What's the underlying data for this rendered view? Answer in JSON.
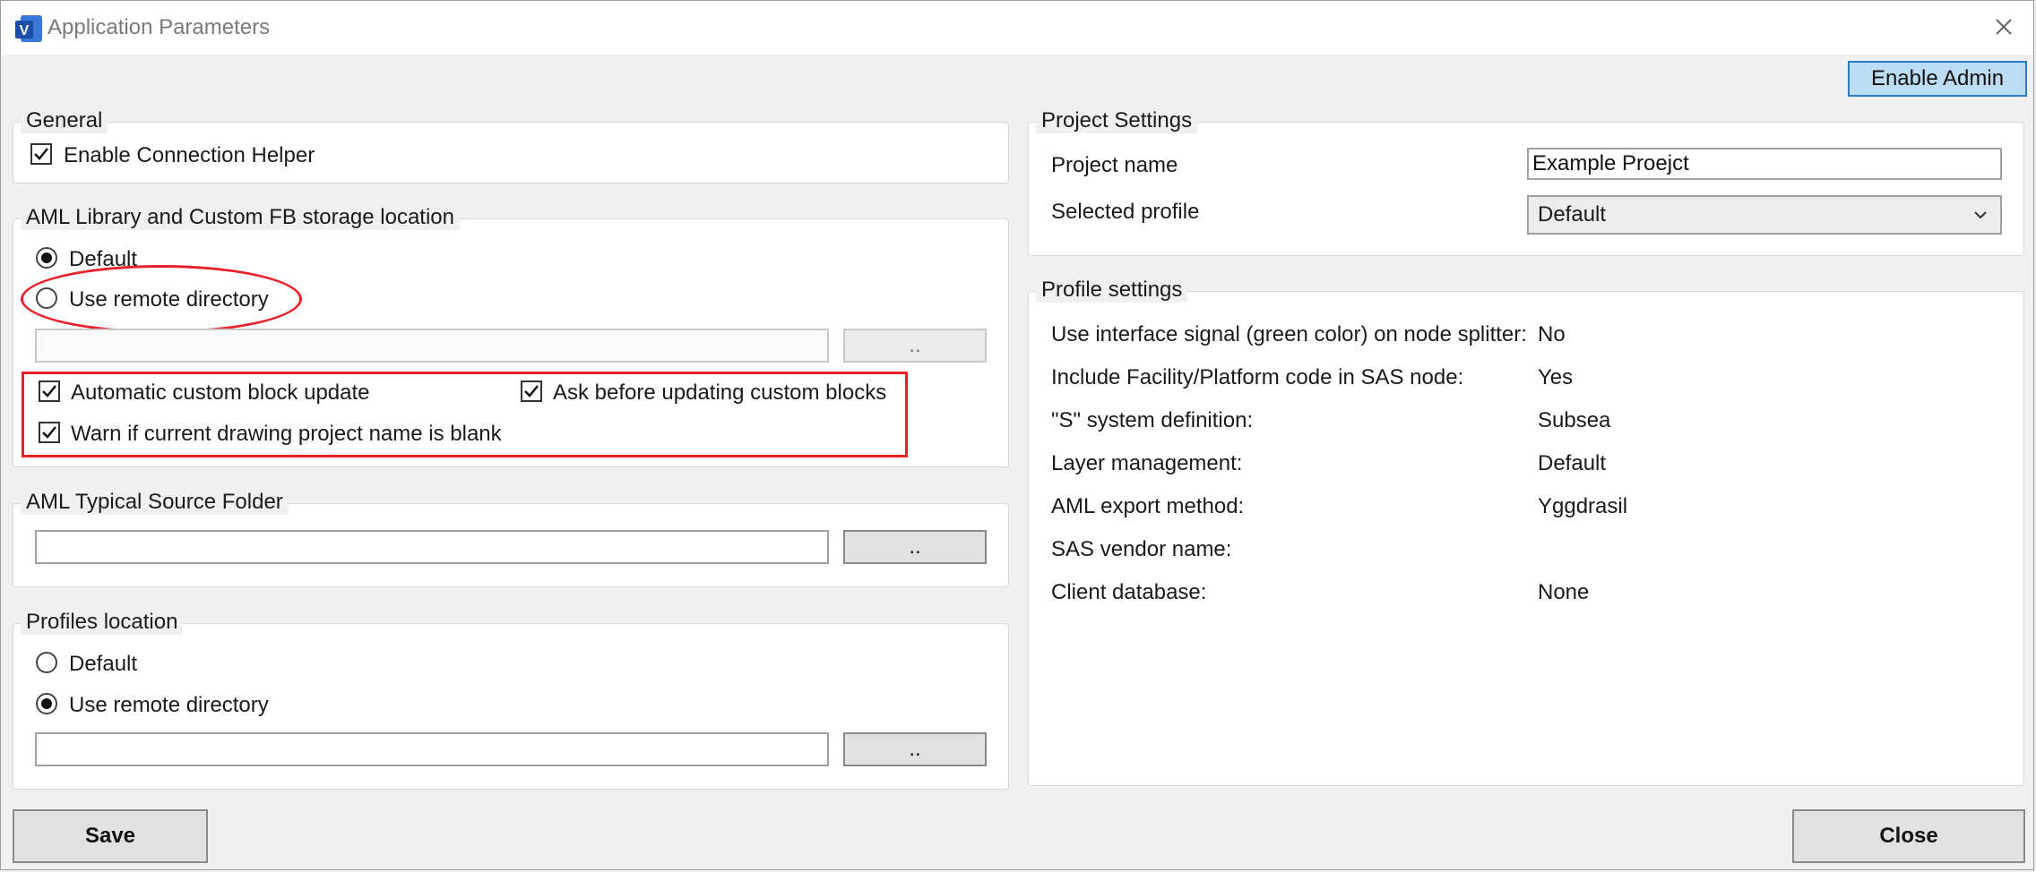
{
  "window": {
    "title": "Application Parameters"
  },
  "toolbar": {
    "enable_admin_label": "Enable Admin"
  },
  "general": {
    "title": "General",
    "enable_connection_helper": {
      "label": "Enable Connection Helper",
      "checked": true
    }
  },
  "aml_library": {
    "title": "AML Library and Custom FB storage location",
    "radio_default": {
      "label": "Default",
      "selected": true
    },
    "radio_remote": {
      "label": "Use remote directory",
      "selected": false
    },
    "path_value": "",
    "browse_label": "..",
    "auto_update": {
      "label": "Automatic custom block update",
      "checked": true
    },
    "ask_before": {
      "label": "Ask before updating custom blocks",
      "checked": true
    },
    "warn_blank": {
      "label": "Warn if current drawing project name is blank",
      "checked": true
    }
  },
  "aml_typical": {
    "title": "AML Typical Source Folder",
    "path_value": "",
    "browse_label": ".."
  },
  "profiles_location": {
    "title": "Profiles location",
    "radio_default": {
      "label": "Default",
      "selected": false
    },
    "radio_remote": {
      "label": "Use remote directory",
      "selected": true
    },
    "path_value": "",
    "browse_label": ".."
  },
  "project_settings": {
    "title": "Project Settings",
    "project_name_label": "Project name",
    "project_name_value": "Example Proejct",
    "selected_profile_label": "Selected profile",
    "selected_profile_value": "Default"
  },
  "profile_settings": {
    "title": "Profile settings",
    "rows": [
      {
        "label": "Use interface signal (green color) on node splitter:",
        "value": "No"
      },
      {
        "label": "Include Facility/Platform code in SAS node:",
        "value": "Yes"
      },
      {
        "label": "\"S\" system definition:",
        "value": "Subsea"
      },
      {
        "label": "Layer management:",
        "value": "Default"
      },
      {
        "label": "AML export method:",
        "value": "Yggdrasil"
      },
      {
        "label": "SAS vendor name:",
        "value": ""
      },
      {
        "label": "Client database:",
        "value": "None"
      }
    ]
  },
  "footer": {
    "save_label": "Save",
    "close_label": "Close"
  },
  "colors": {
    "annotation_red": "#e8202a",
    "admin_button_bg": "#bcdcf4",
    "admin_button_border": "#2b7bc7"
  },
  "icons": {
    "app": "visio-app-icon",
    "close": "close-icon",
    "checkbox": "checkmark-icon",
    "dropdown": "chevron-down-icon"
  }
}
